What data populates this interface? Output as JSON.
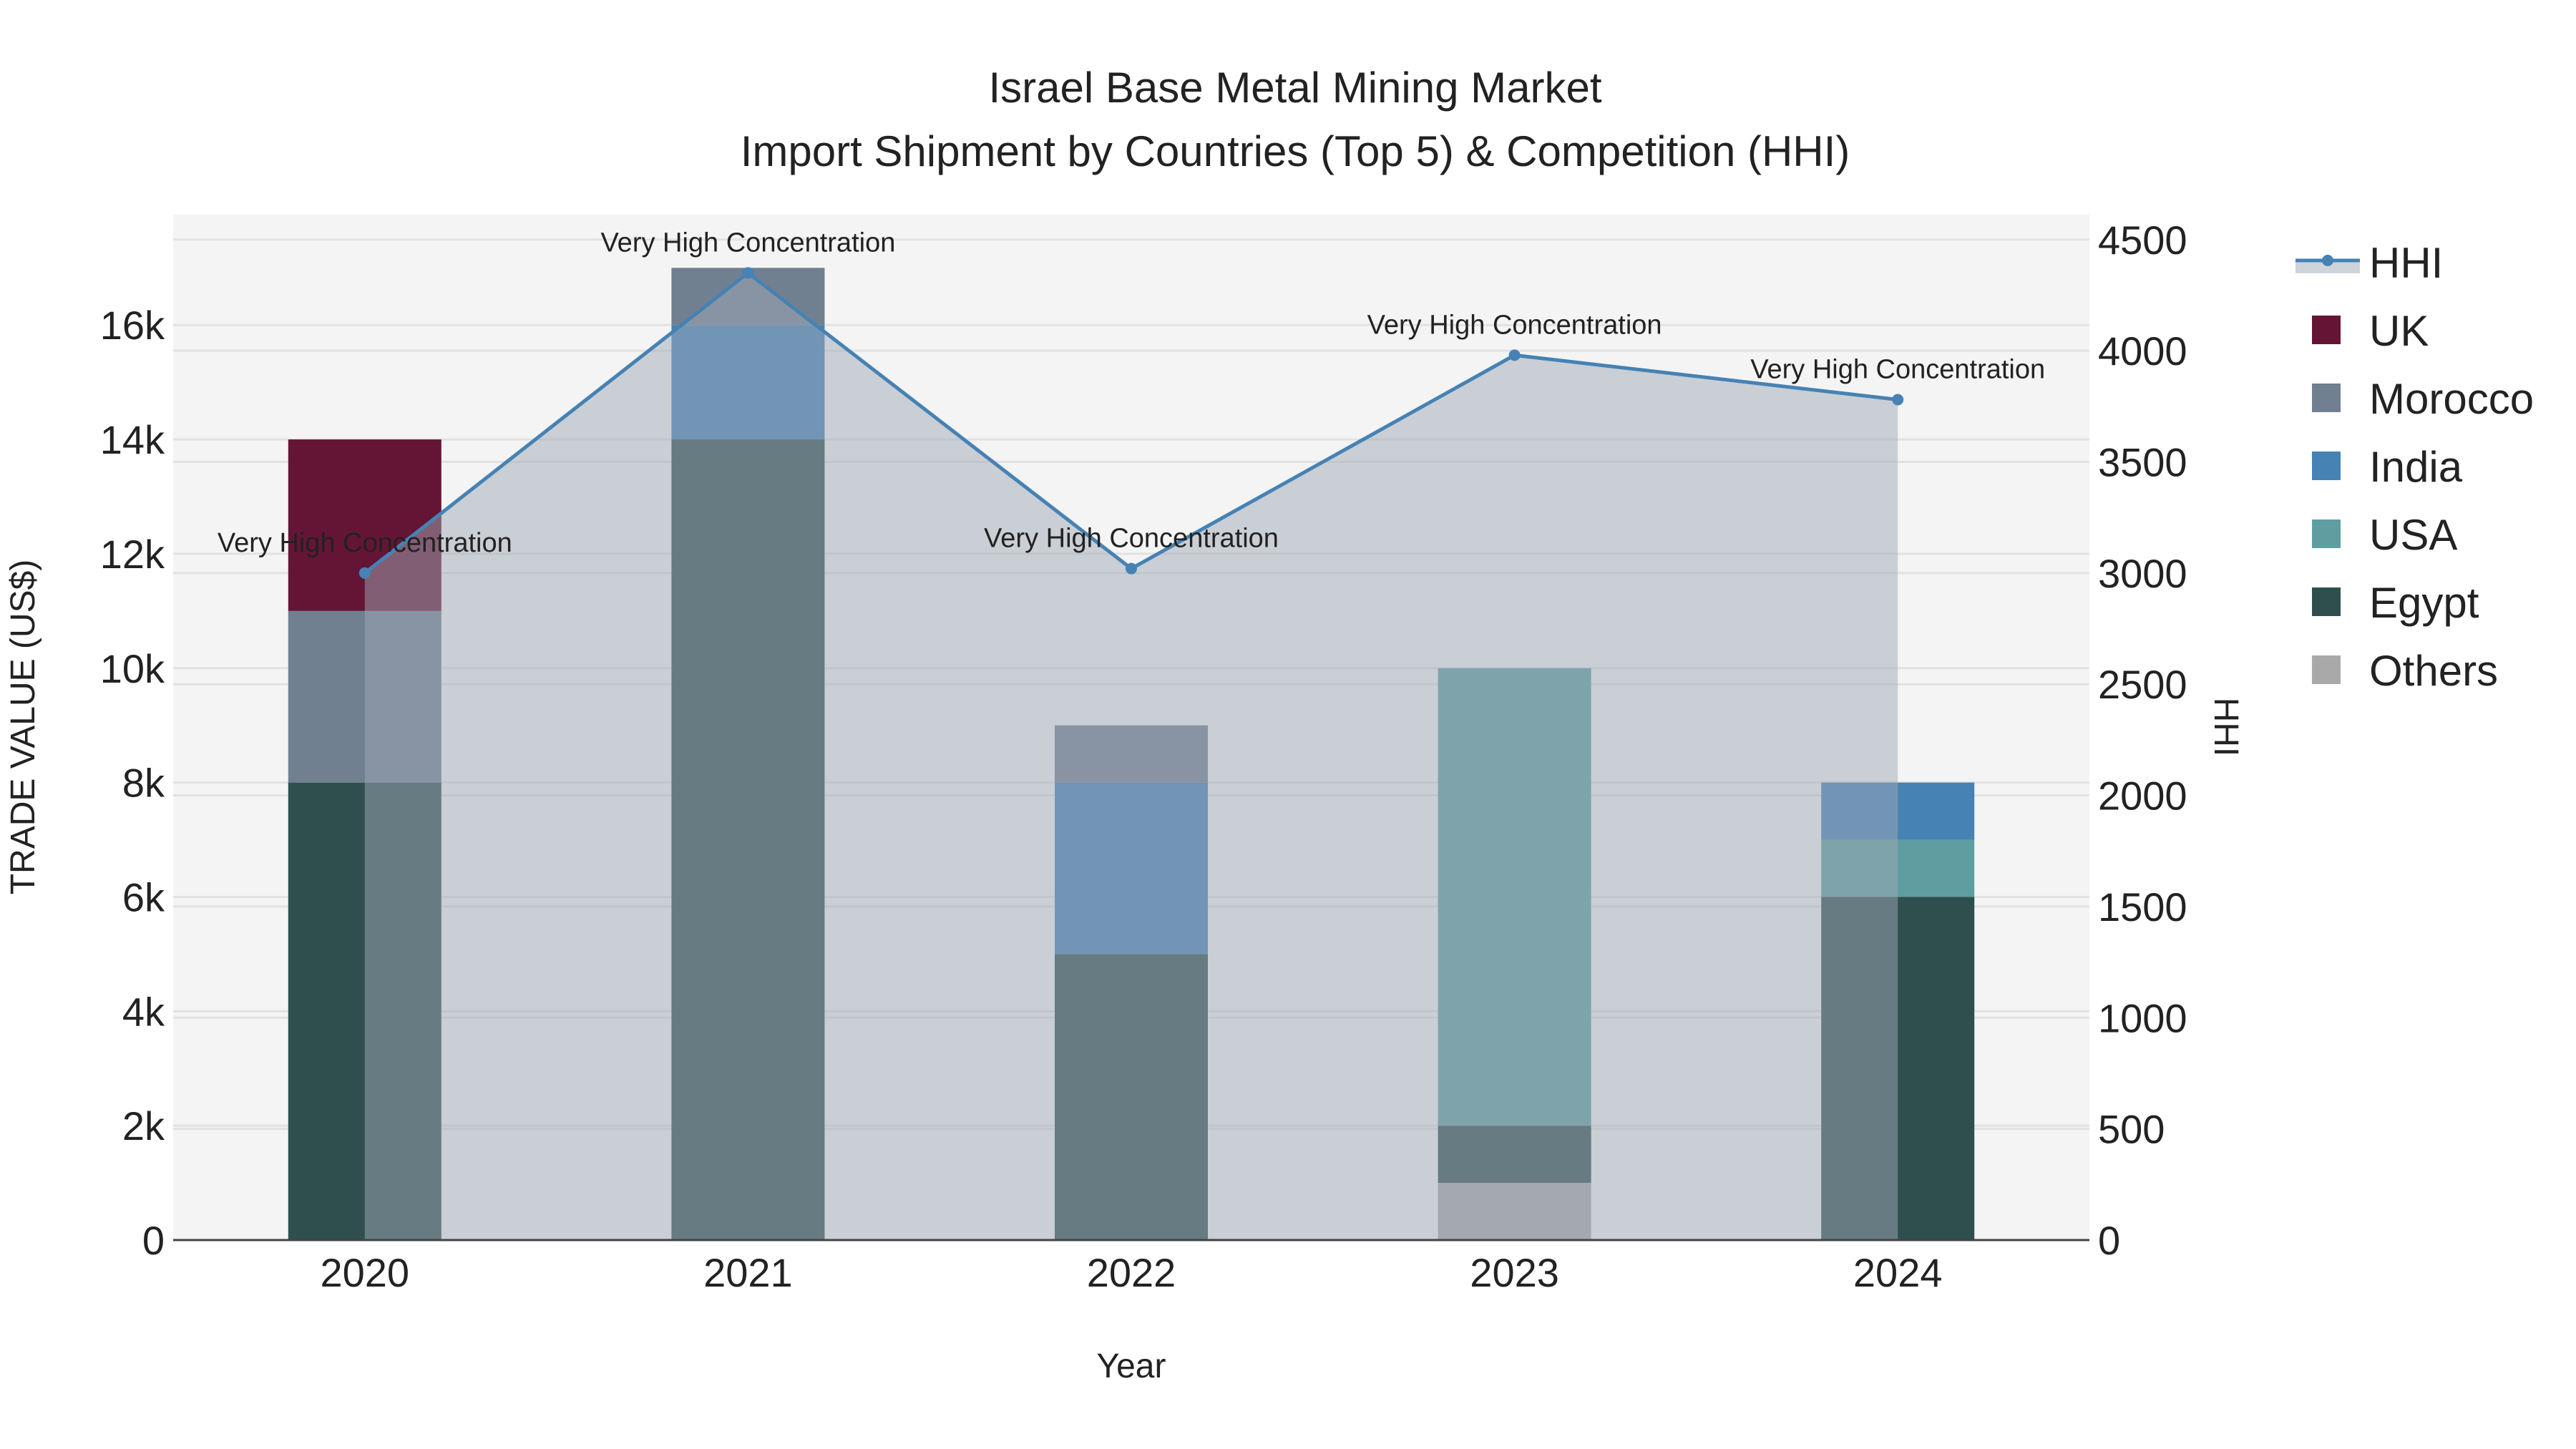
{
  "chart_data": {
    "type": "bar",
    "title_line1": "Israel Base Metal Mining Market",
    "title_line2": "Import Shipment by Countries (Top 5) & Competition (HHI)",
    "xlabel": "Year",
    "ylabel": "TRADE VALUE (US$)",
    "y2label": "HHI",
    "categories": [
      "2020",
      "2021",
      "2022",
      "2023",
      "2024"
    ],
    "ylim": [
      0,
      17930
    ],
    "y2lim": [
      0,
      4612
    ],
    "yticks": [
      0,
      2000,
      4000,
      6000,
      8000,
      10000,
      12000,
      14000,
      16000
    ],
    "ytick_labels": [
      "0",
      "2k",
      "4k",
      "6k",
      "8k",
      "10k",
      "12k",
      "14k",
      "16k"
    ],
    "y2ticks": [
      0,
      500,
      1000,
      1500,
      2000,
      2500,
      3000,
      3500,
      4000,
      4500
    ],
    "y2tick_labels": [
      "0",
      "500",
      "1000",
      "1500",
      "2000",
      "2500",
      "3000",
      "3500",
      "4000",
      "4500"
    ],
    "grid": true,
    "legend_position": "right",
    "series": [
      {
        "name": "Egypt",
        "color": "#2f4f4f",
        "values": [
          8000,
          14000,
          5000,
          1000,
          6000
        ]
      },
      {
        "name": "USA",
        "color": "#5f9ea0",
        "values": [
          0,
          0,
          0,
          8000,
          1000
        ]
      },
      {
        "name": "India",
        "color": "#4682b4",
        "values": [
          0,
          2000,
          3000,
          0,
          1000
        ]
      },
      {
        "name": "Morocco",
        "color": "#708090",
        "values": [
          3000,
          1000,
          1000,
          0,
          0
        ]
      },
      {
        "name": "UK",
        "color": "#641535",
        "values": [
          3000,
          0,
          0,
          0,
          0
        ]
      },
      {
        "name": "Others",
        "color": "#a9a9a9",
        "values": [
          0,
          0,
          0,
          1000,
          0
        ]
      }
    ],
    "stack_order": [
      "Others",
      "Egypt",
      "USA",
      "India",
      "Morocco",
      "UK"
    ],
    "hhi": {
      "name": "HHI",
      "color": "#4682b4",
      "values": [
        3000,
        4350,
        3020,
        3980,
        3780
      ],
      "annotations": [
        "Very High Concentration",
        "Very High Concentration",
        "Very High Concentration",
        "Very High Concentration",
        "Very High Concentration"
      ]
    },
    "legend": [
      "HHI",
      "UK",
      "Morocco",
      "India",
      "USA",
      "Egypt",
      "Others"
    ]
  }
}
